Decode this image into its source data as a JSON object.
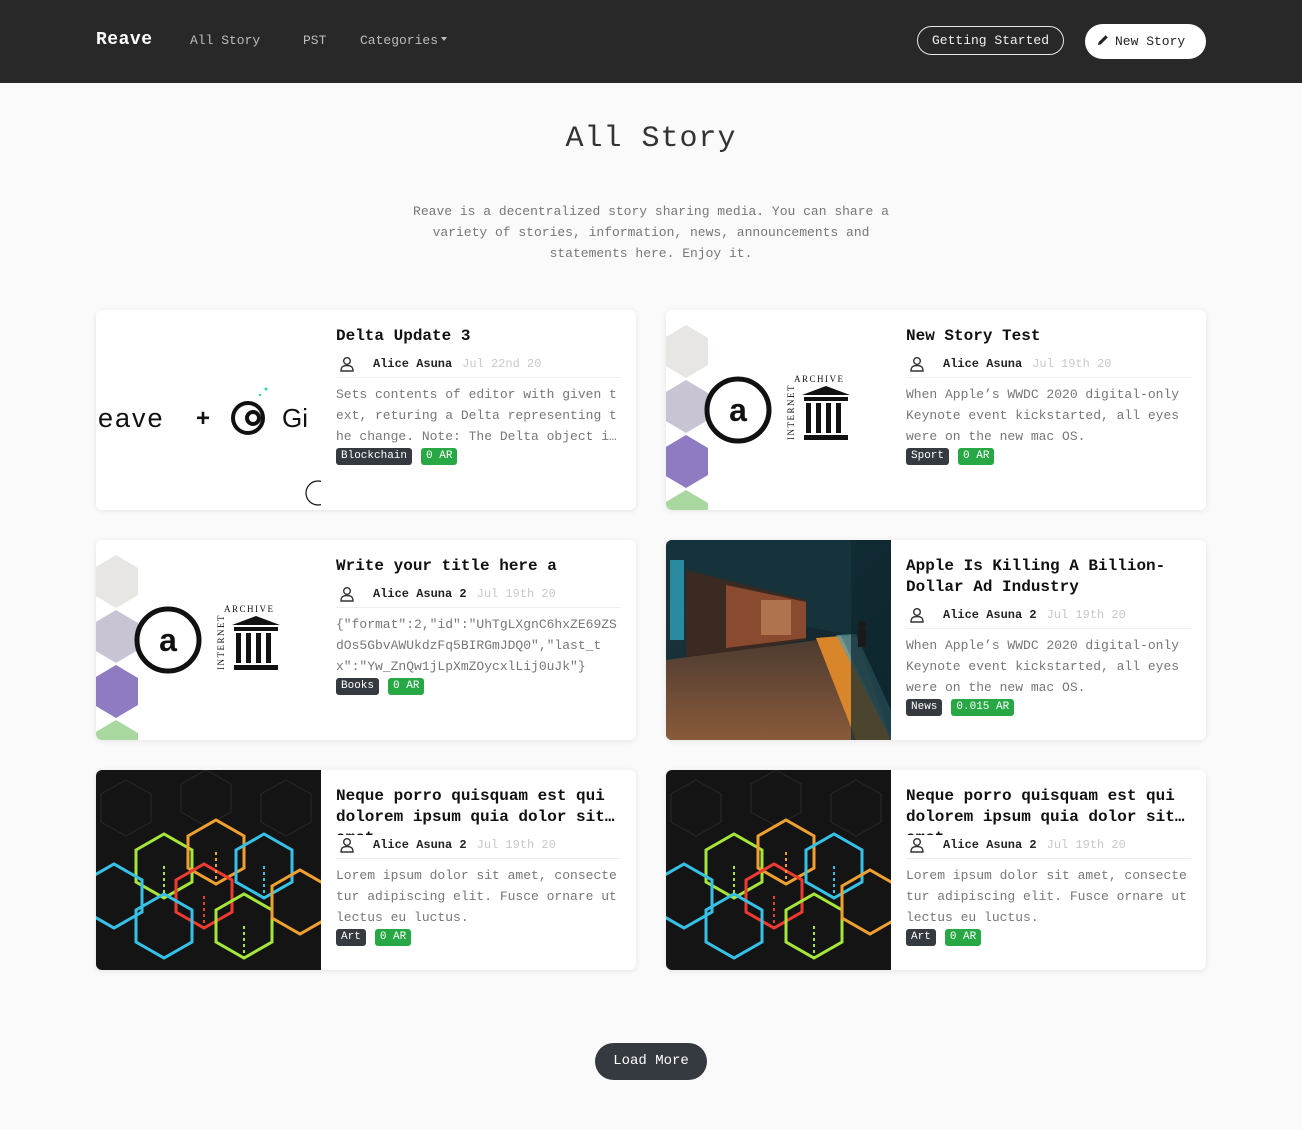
{
  "nav": {
    "brand": "Reave",
    "links": [
      "All Story",
      "PST",
      "Categories"
    ],
    "getting_started": "Getting Started",
    "new_story": "New Story"
  },
  "hero": {
    "title": "All Story",
    "description": "Reave is a decentralized story sharing media. You can share a variety of stories, information, news, announcements and statements here. Enjoy it."
  },
  "stories": [
    {
      "title": "Delta Update 3",
      "author": "Alice Asuna",
      "date": "Jul 22nd 20",
      "excerpt": "Sets contents of editor with given text, returing a Delta representing the change. Note: The Delta object is returned.",
      "category": "Blockchain",
      "price": "0 AR",
      "image": "reave-gitcoin-banner"
    },
    {
      "title": "New Story Test",
      "author": "Alice Asuna",
      "date": "Jul 19th 20",
      "excerpt": "When Apple’s WWDC 2020 digital-only Keynote event kickstarted, all eyes were on the new mac OS.",
      "category": "Sport",
      "price": "0 AR",
      "image": "arweave-internet-archive-logo"
    },
    {
      "title": "Write your title here a",
      "author": "Alice Asuna 2",
      "date": "Jul 19th 20",
      "excerpt": "{\"format\":2,\"id\":\"UhTgLXgnC6hxZE69ZSdOs5GbvAWUkdzFq5BIRGmJDQ0\",\"last_tx\":\"Yw_ZnQw1jLpXmZOycxlLij0uJk\"}",
      "category": "Books",
      "price": "0 AR",
      "image": "arweave-internet-archive-logo"
    },
    {
      "title": "Apple Is Killing A Billion-Dollar Ad Industry",
      "author": "Alice Asuna 2",
      "date": "Jul 19th 20",
      "excerpt": "When Apple’s WWDC 2020 digital-only Keynote event kickstarted, all eyes were on the new mac OS.",
      "category": "News",
      "price": "0.015 AR",
      "image": "subway-platform-photo"
    },
    {
      "title": "Neque porro quisquam est qui dolorem ipsum quia dolor sit amet",
      "author": "Alice Asuna 2",
      "date": "Jul 19th 20",
      "excerpt": "Lorem ipsum dolor sit amet, consectetur adipiscing elit. Fusce ornare ut lectus eu luctus.",
      "category": "Art",
      "price": "0 AR",
      "image": "neon-cubes-illustration"
    },
    {
      "title": "Neque porro quisquam est qui dolorem ipsum quia dolor sit amet",
      "author": "Alice Asuna 2",
      "date": "Jul 19th 20",
      "excerpt": "Lorem ipsum dolor sit amet, consectetur adipiscing elit. Fusce ornare ut lectus eu luctus.",
      "category": "Art",
      "price": "0 AR",
      "image": "neon-cubes-illustration"
    }
  ],
  "load_more": "Load More",
  "colors": {
    "navbar": "#282828",
    "tag_dark": "#343a40",
    "tag_green": "#28a745",
    "page_bg": "#fafafa"
  }
}
